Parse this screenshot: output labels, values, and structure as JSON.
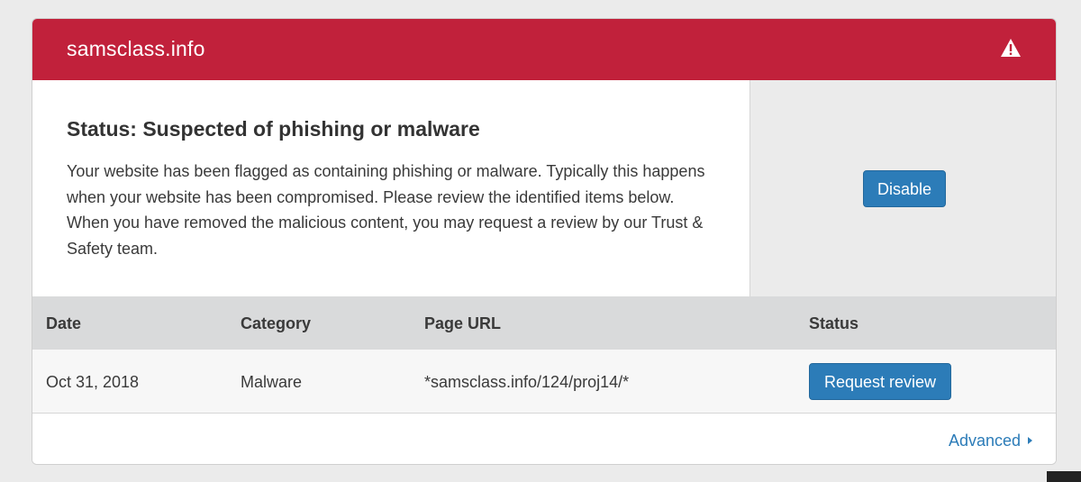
{
  "header": {
    "site_name": "samsclass.info",
    "icon": "warning-triangle-icon",
    "color": "#c1213b"
  },
  "status": {
    "title": "Status: Suspected of phishing or malware",
    "description": "Your website has been flagged as containing phishing or malware. Typically this happens when your website has been compromised. Please review the identified items below. When you have removed the malicious content, you may request a review by our Trust & Safety team."
  },
  "actions": {
    "disable_label": "Disable"
  },
  "table": {
    "columns": [
      "Date",
      "Category",
      "Page URL",
      "Status"
    ],
    "rows": [
      {
        "date": "Oct 31, 2018",
        "category": "Malware",
        "page_url": "*samsclass.info/124/proj14/*",
        "status_action": "Request review"
      }
    ]
  },
  "footer": {
    "advanced_label": "Advanced"
  },
  "colors": {
    "accent": "#2c7cb8",
    "danger": "#c1213b"
  }
}
